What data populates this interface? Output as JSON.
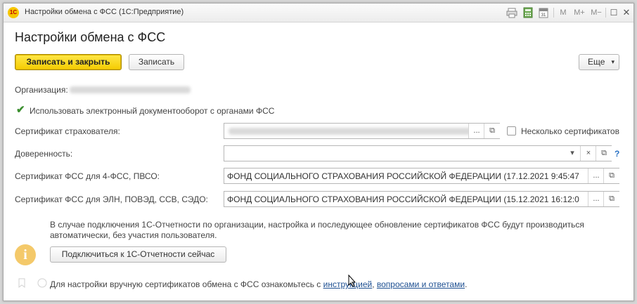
{
  "window": {
    "title": "Настройки обмена с ФСС  (1С:Предприятие)",
    "logo": "1С",
    "toolbar": {
      "m": "M",
      "m_plus": "M+",
      "m_minus": "M−",
      "maximize": "☐",
      "close": "✕"
    }
  },
  "form": {
    "heading": "Настройки обмена с ФСС",
    "save_close_label": "Записать и закрыть",
    "save_label": "Записать",
    "more_label": "Еще"
  },
  "organization": {
    "label": "Организация:"
  },
  "edo": {
    "checked": true,
    "label": "Использовать электронный документооборот с органами ФСС"
  },
  "insurer_cert": {
    "label": "Сертификат страхователя:",
    "multiple_label": "Несколько сертификатов",
    "multiple_checked": false
  },
  "power_of_attorney": {
    "label": "Доверенность:",
    "value": "",
    "help": "?"
  },
  "cert_4fss": {
    "label": "Сертификат ФСС для 4-ФСС, ПВСО:",
    "value": "ФОНД СОЦИАЛЬНОГО СТРАХОВАНИЯ РОССИЙСКОЙ ФЕДЕРАЦИИ (17.12.2021 9:45:47"
  },
  "cert_eln": {
    "label": "Сертификат ФСС для ЭЛН, ПОВЭД, ССВ, СЭДО:",
    "value": "ФОНД СОЦИАЛЬНОГО СТРАХОВАНИЯ РОССИЙСКОЙ ФЕДЕРАЦИИ (15.12.2021 16:12:0"
  },
  "info": {
    "line1": "В случае подключения 1С-Отчетности по организации, настройка и последующее обновление сертификатов ФСС будут производиться",
    "line2": "автоматически, без участия пользователя.",
    "connect_label": "Подключиться к 1С-Отчетности сейчас"
  },
  "footer": {
    "text": "Для настройки вручную сертификатов обмена с ФСС ознакомьтесь с ",
    "link1": "инструкцией",
    "sep": ", ",
    "link2": "вопросами и ответами",
    "end": "."
  },
  "icons": {
    "checkmark": "✔",
    "info": "i",
    "ellipsis": "...",
    "open": "⧉",
    "dropdown": "▾",
    "clear": "×"
  }
}
